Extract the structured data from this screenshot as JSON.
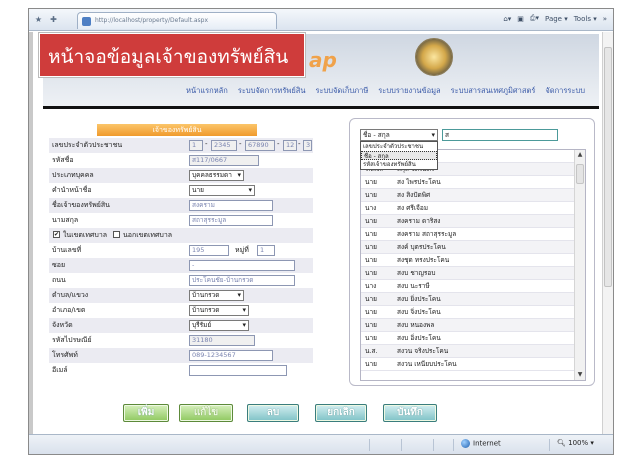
{
  "browser": {
    "tab_title": "http://localhost/property/Default.aspx",
    "toolbar_items": [
      "Page ▾",
      "Tools ▾",
      "»"
    ],
    "status_zone": "Internet",
    "zoom": "100%"
  },
  "header": {
    "title": "หน้าจอข้อมูลเจ้าของทรัพย์สิน",
    "logo_fragment": "ap",
    "menu": [
      "หน้าแรกหลัก",
      "ระบบจัดการทรัพย์สิน",
      "ระบบจัดเก็บภาษี",
      "ระบบรายงานข้อมูล",
      "ระบบสารสนเทศภูมิศาสตร์",
      "จัดการระบบ"
    ]
  },
  "form": {
    "heading": "เจ้าของทรัพย์สิน",
    "labels": {
      "id_card": "เลขประจำตัวประชาชน",
      "code": "รหัสชื่อ",
      "person_type": "ประเภทบุคคล",
      "prefix": "คำนำหน้าชื่อ",
      "owner_name": "ชื่อเจ้าของทรัพย์สิน",
      "surname": "นามสกุล",
      "house_no": "บ้านเลขที่",
      "moo": "หมู่ที่",
      "soi": "ซอย",
      "road": "ถนน",
      "subdistrict": "ตำบล/แขวง",
      "district": "อำเภอ/เขต",
      "province": "จังหวัด",
      "postcode": "รหัสไปรษณีย์",
      "phone": "โทรศัพท์",
      "email": "อีเมล์"
    },
    "values": {
      "id_1": "1",
      "id_2": "2345",
      "id_3": "67890",
      "id_4": "12",
      "id_5": "3",
      "code": "ส117/0667",
      "person_type": "บุคคลธรรมดา",
      "prefix": "นาย",
      "owner_name": "สงคราม",
      "surname": "สถาสุรระมูล",
      "house_no": "195",
      "moo": "1",
      "soi": "-",
      "road": "ประโคนชัย-บ้านกรวด",
      "subdistrict": "บ้านกรวด",
      "district": "บ้านกรวด",
      "province": "บุรีรัมย์",
      "postcode": "31180",
      "phone": "089-1234567",
      "email": ""
    },
    "in_area_label": "ในเขตเทศบาล",
    "out_area_label": "นอกเขตเทศบาล"
  },
  "search": {
    "selected_field": "ชื่อ - สกุล",
    "query": "ส",
    "dropdown_options": [
      "เลขประจำตัวประชาชน",
      "ชื่อ - สกุล",
      "รหัสเจ้าของทรัพย์สิน"
    ]
  },
  "owner_list": [
    {
      "prefix": "",
      "name": "โคน"
    },
    {
      "prefix": "ร.ต.ต.",
      "name": "สกุล จิตรมิตร"
    },
    {
      "prefix": "นาย",
      "name": "สง ไพรประโคน"
    },
    {
      "prefix": "นาย",
      "name": "สง สิงปัดพิศ"
    },
    {
      "prefix": "นาง",
      "name": "สง ศรีเจือม"
    },
    {
      "prefix": "นาย",
      "name": "สงคราม ดาริสง"
    },
    {
      "prefix": "นาย",
      "name": "สงคราม สถาสุรระมูล"
    },
    {
      "prefix": "นาย",
      "name": "สงค์ บุตรประโคน"
    },
    {
      "prefix": "นาย",
      "name": "สงชุด ทรงประโคน"
    },
    {
      "prefix": "นาย",
      "name": "สงบ ชาญรอบ"
    },
    {
      "prefix": "นาง",
      "name": "สงบ นะราษี"
    },
    {
      "prefix": "นาย",
      "name": "สงบ ยิ่งประโคน"
    },
    {
      "prefix": "นาย",
      "name": "สงบ จิ่งประโคน"
    },
    {
      "prefix": "นาย",
      "name": "สงบ หนองพล"
    },
    {
      "prefix": "นาย",
      "name": "สงบ อิ่งประโคน"
    },
    {
      "prefix": "น.ส.",
      "name": "สงวน จริงประโคน"
    },
    {
      "prefix": "นาย",
      "name": "สงวน เหนียบประโคน"
    }
  ],
  "buttons": {
    "add": "เพิ่ม",
    "edit": "แก้ไข",
    "delete": "ลบ",
    "cancel": "ยกเลิก",
    "save": "บันทึก"
  },
  "colors": {
    "title_red": "#cf3c3b",
    "form_head_orange": "#f09a2d",
    "button_green": "#8fc860",
    "button_teal": "#7fc2c6",
    "menu_blue": "#3a5aa8"
  }
}
